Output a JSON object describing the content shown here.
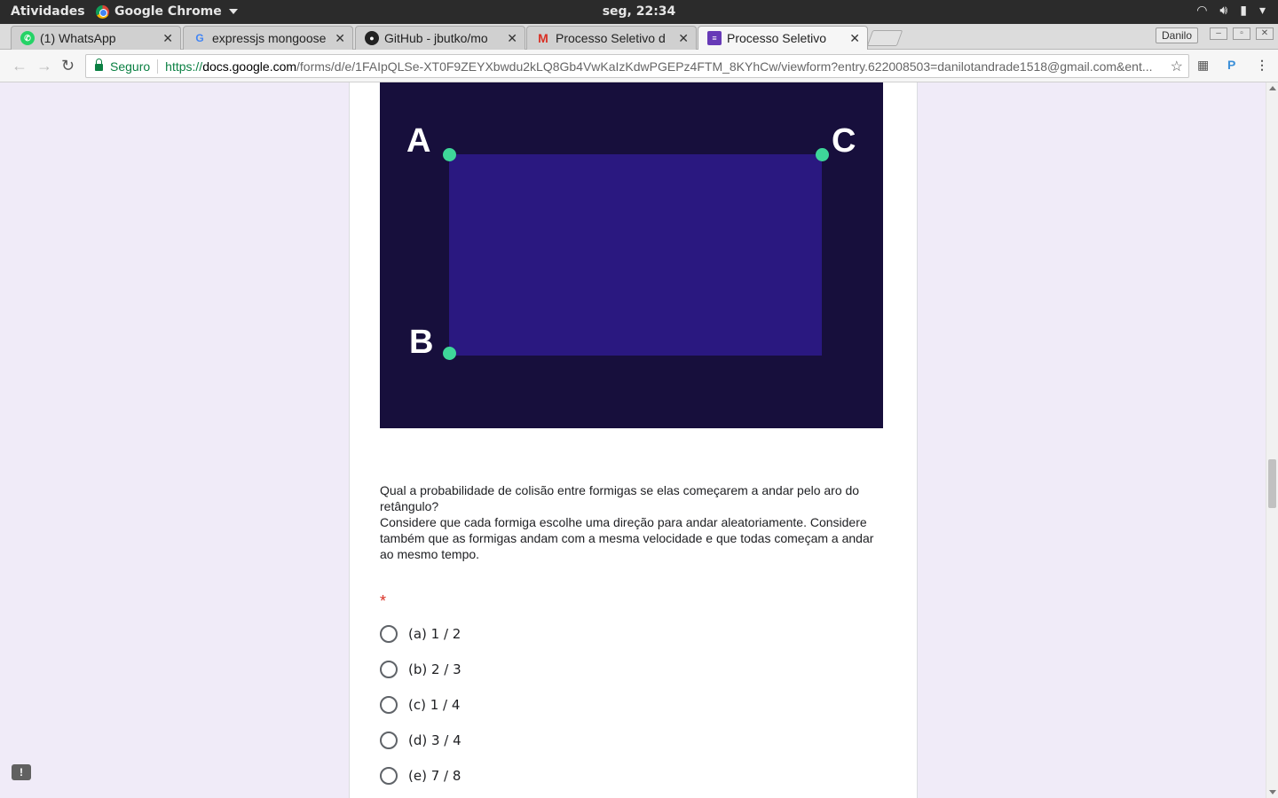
{
  "system": {
    "activities": "Atividades",
    "app_name": "Google Chrome",
    "clock": "seg, 22:34"
  },
  "tabs": [
    {
      "title": "(1) WhatsApp",
      "icon": "whatsapp-icon",
      "active": false
    },
    {
      "title": "expressjs mongoose",
      "icon": "google-icon",
      "active": false
    },
    {
      "title": "GitHub - jbutko/mo",
      "icon": "github-icon",
      "active": false
    },
    {
      "title": "Processo Seletivo d",
      "icon": "gmail-icon",
      "active": false
    },
    {
      "title": "Processo Seletivo",
      "icon": "forms-icon",
      "active": true
    }
  ],
  "profile": "Danilo",
  "address": {
    "secure_label": "Seguro",
    "scheme": "https://",
    "host": "docs.google.com",
    "path": "/forms/d/e/1FAIpQLSe-XT0F9ZEYXbwdu2kLQ8Gb4VwKaIzKdwPGEPz4FTM_8KYhCw/viewform?entry.622008503=danilotandrade1518@gmail.com&ent..."
  },
  "figure": {
    "labels": [
      "A",
      "C",
      "B"
    ],
    "colors": {
      "background": "#170f3c",
      "rectangle": "#2a1880",
      "points": "#3ed699"
    }
  },
  "question": {
    "line1": "Qual a probabilidade de colisão entre formigas se elas começarem a andar pelo aro do retângulo?",
    "line2": "Considere que cada formiga escolhe uma direção para andar aleatoriamente. Considere também que as formigas andam com a mesma velocidade e que todas começam a andar ao mesmo tempo.",
    "required_mark": "*"
  },
  "options": [
    {
      "label": "(a) 1 / 2"
    },
    {
      "label": "(b) 2 / 3"
    },
    {
      "label": "(c) 1 / 4"
    },
    {
      "label": "(d) 3 / 4"
    },
    {
      "label": "(e) 7 / 8"
    }
  ],
  "feedback_icon": "!"
}
